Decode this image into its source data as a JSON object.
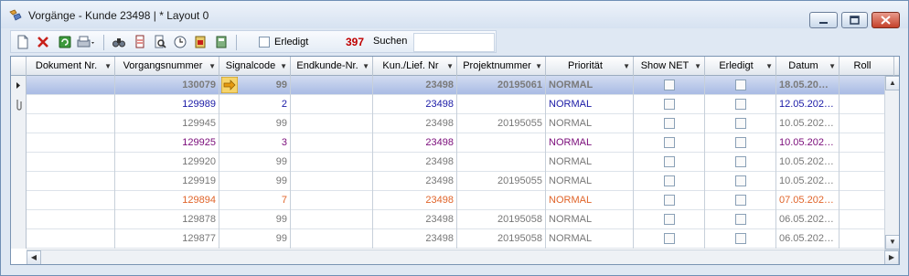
{
  "window": {
    "title": "Vorgänge  -  Kunde 23498 | * Layout 0"
  },
  "toolbar": {
    "erledigt_label": "Erledigt",
    "count": "397",
    "search_label": "Suchen",
    "search_value": ""
  },
  "columns": [
    "Dokument Nr.",
    "Vorgangsnummer",
    "Signalcode",
    "Endkunde-Nr.",
    "Kun./Lief. Nr",
    "Projektnummer",
    "Priorität",
    "Show NET",
    "Erledigt",
    "Datum",
    "Roll"
  ],
  "colors": {
    "dimmed": "#777777",
    "blue": "#1a1aa6",
    "purple": "#7a0c7a",
    "orange": "#e0642a",
    "selected_text": "#7a7a7a"
  },
  "rows": [
    {
      "dok": "",
      "vorgang": "130079",
      "signal": "99",
      "endkunde": "",
      "kunde": "23498",
      "projekt": "20195061",
      "prio": "NORMAL",
      "datum": "18.05.20…",
      "color": "selected",
      "arrow": true
    },
    {
      "dok": "",
      "vorgang": "129989",
      "signal": "2",
      "endkunde": "",
      "kunde": "23498",
      "projekt": "",
      "prio": "NORMAL",
      "datum": "12.05.202…",
      "color": "blue"
    },
    {
      "dok": "",
      "vorgang": "129945",
      "signal": "99",
      "endkunde": "",
      "kunde": "23498",
      "projekt": "20195055",
      "prio": "NORMAL",
      "datum": "10.05.202…",
      "color": "dimmed"
    },
    {
      "dok": "",
      "vorgang": "129925",
      "signal": "3",
      "endkunde": "",
      "kunde": "23498",
      "projekt": "",
      "prio": "NORMAL",
      "datum": "10.05.202…",
      "color": "purple"
    },
    {
      "dok": "",
      "vorgang": "129920",
      "signal": "99",
      "endkunde": "",
      "kunde": "23498",
      "projekt": "",
      "prio": "NORMAL",
      "datum": "10.05.202…",
      "color": "dimmed"
    },
    {
      "dok": "",
      "vorgang": "129919",
      "signal": "99",
      "endkunde": "",
      "kunde": "23498",
      "projekt": "20195055",
      "prio": "NORMAL",
      "datum": "10.05.202…",
      "color": "dimmed"
    },
    {
      "dok": "",
      "vorgang": "129894",
      "signal": "7",
      "endkunde": "",
      "kunde": "23498",
      "projekt": "",
      "prio": "NORMAL",
      "datum": "07.05.202…",
      "color": "orange"
    },
    {
      "dok": "",
      "vorgang": "129878",
      "signal": "99",
      "endkunde": "",
      "kunde": "23498",
      "projekt": "20195058",
      "prio": "NORMAL",
      "datum": "06.05.202…",
      "color": "dimmed"
    },
    {
      "dok": "",
      "vorgang": "129877",
      "signal": "99",
      "endkunde": "",
      "kunde": "23498",
      "projekt": "20195058",
      "prio": "NORMAL",
      "datum": "06.05.202…",
      "color": "dimmed"
    }
  ]
}
